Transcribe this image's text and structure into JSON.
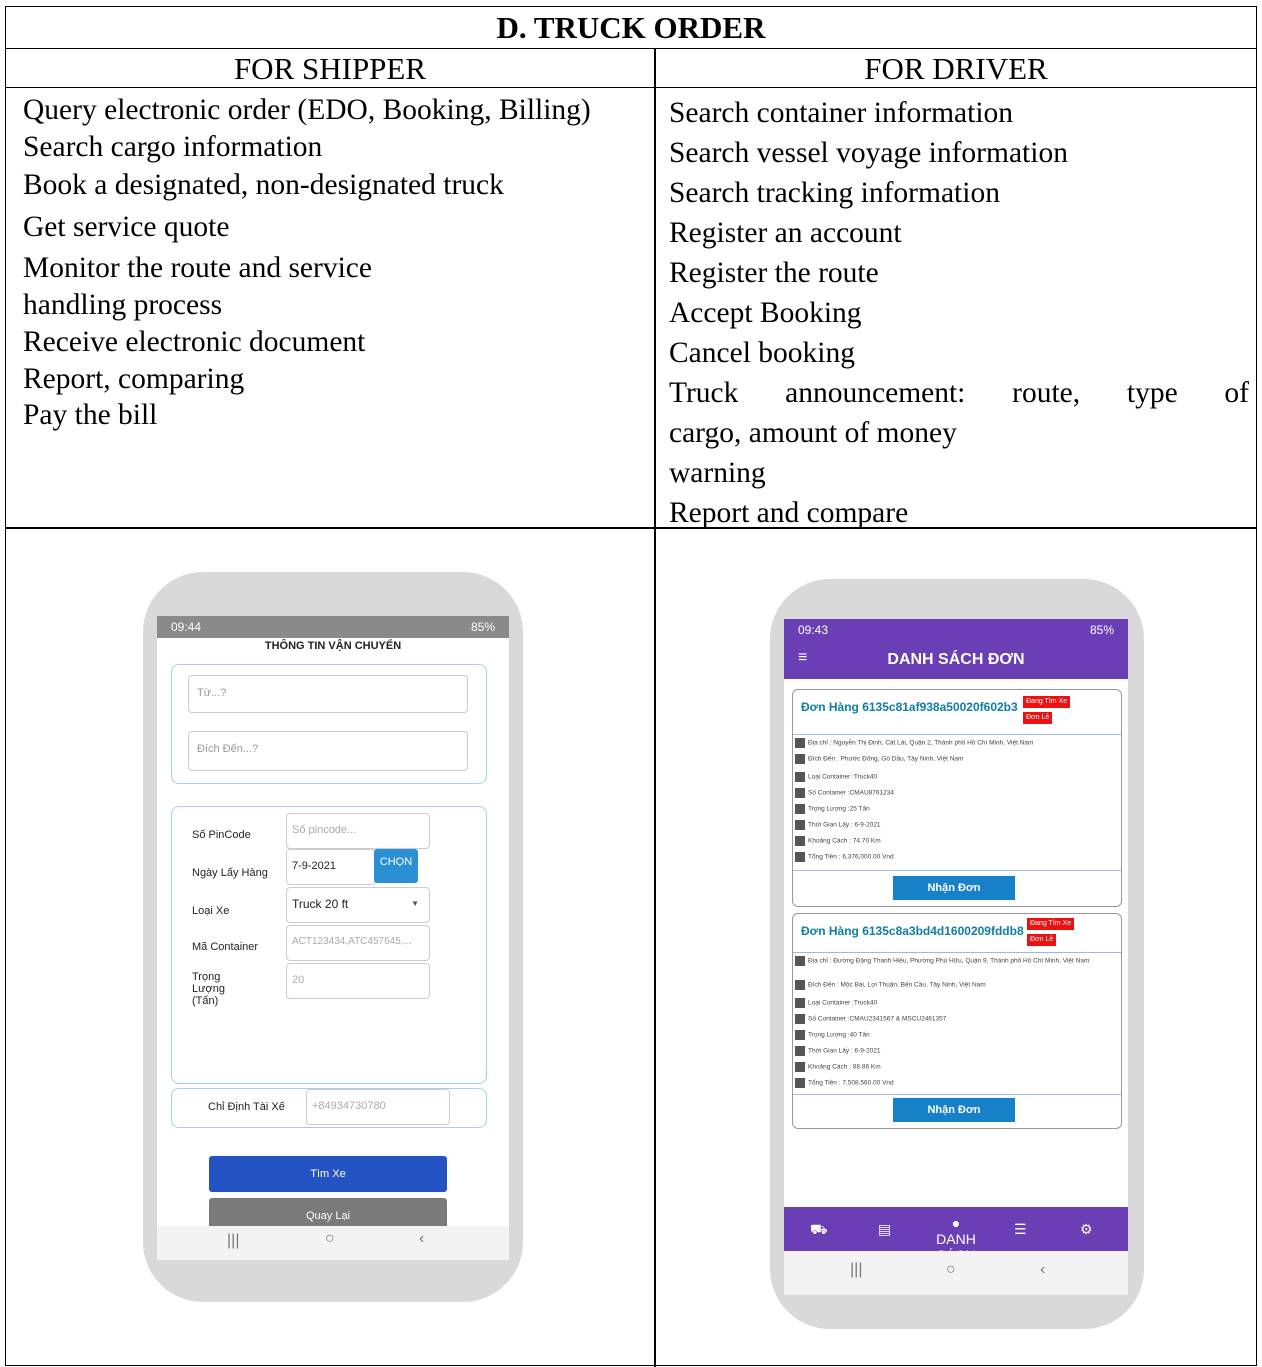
{
  "title": "D. TRUCK ORDER",
  "columns": {
    "left": "FOR SHIPPER",
    "right": "FOR DRIVER"
  },
  "shipper_items": [
    "Query electronic order (EDO, Booking, Billing)",
    "Search cargo information",
    "Book a designated, non-designated truck",
    "Get service quote",
    "Monitor the route and service",
    "handling process",
    "Receive electronic document",
    "Report, comparing",
    "Pay the bill"
  ],
  "driver_items": [
    "Search container information",
    "Search vessel voyage information",
    "Search tracking information",
    "Register an account",
    "Register the route",
    "Accept Booking",
    "Cancel booking",
    "Truck announcement: route, type of",
    "cargo, amount of money",
    "warning",
    "Report and compare"
  ],
  "shipper_phone": {
    "time": "09:44",
    "status": "85%",
    "title": "THÔNG TIN VẬN CHUYỂN",
    "from_placeholder": "Từ...?",
    "to_placeholder": "Đích Đến...?",
    "pincode_label": "Số PinCode",
    "pincode_placeholder": "Số pincode...",
    "date_label": "Ngày Lấy Hàng",
    "date_value": "7-9-2021",
    "choose": "CHỌN",
    "truck_label": "Loại Xe",
    "truck_value": "Truck 20 ft",
    "container_label": "Mã Container",
    "container_placeholder": "ACT123434,ATC457645,...",
    "weight_label": "Trọng Lượng (Tấn)",
    "weight_value": "20",
    "driver_label": "Chỉ Định Tài Xế",
    "driver_value": "+84934730780",
    "find_button": "Tìm Xe",
    "back_button": "Quay Lại"
  },
  "driver_phone": {
    "time": "09:43",
    "status": "85%",
    "header": "DANH SÁCH ĐƠN",
    "orders": [
      {
        "id": "Đơn Hàng 6135c81af938a50020f602b3",
        "tag1": "Đang Tìm Xe",
        "tag2": "Đơn Lẻ",
        "address": "Địa chỉ : Nguyễn Thị Định, Cát Lái, Quận 2, Thành phố Hồ Chí Minh, Việt Nam",
        "dest": "Đích Đến : Phước Đông, Gò Dầu, Tây Ninh, Việt Nam",
        "container_type": "Loại Container :Truck40",
        "container_no": "Số Container :CMAU8761234",
        "weight": "Trọng Lượng :25 Tấn",
        "pickup": "Thời Gian Lấy : 6-9-2021",
        "distance": "Khoảng Cách : 74.70 Km",
        "total": "Tổng Tiền : 6,376,000.00 Vnd",
        "accept": "Nhận Đơn"
      },
      {
        "id": "Đơn Hàng 6135c8a3bd4d1600209fddb8",
        "tag1": "Đang Tìm Xe",
        "tag2": "Đơn Lẻ",
        "address": "Địa chỉ : Đường Đặng Thanh Hiếu, Phường Phú Hữu, Quận 9, Thành phố Hồ Chí Minh, Việt Nam",
        "dest": "Đích Đến : Mộc Bài, Lợi Thuận, Bến Cầu, Tây Ninh, Việt Nam",
        "container_type": "Loại Container :Truck40",
        "container_no": "Số Container :CMAU2341567 & MSCU2461357",
        "weight": "Trọng Lượng :40 Tấn",
        "pickup": "Thời Gian Lấy : 6-9-2021",
        "distance": "Khoảng Cách : 88.86 Km",
        "total": "Tổng Tiền : 7,508,560.00 Vnd",
        "accept": "Nhận Đơn"
      }
    ],
    "active_tab": "DANH SÁCH"
  },
  "icons": [
    "truck-icon",
    "clipboard-icon",
    "location-pin-icon",
    "user-list-icon",
    "gear-icon",
    "menu-icon",
    "ruler-icon",
    "scale-icon",
    "calendar-icon",
    "money-icon",
    "barcode-icon",
    "home-nav-icon",
    "back-nav-icon",
    "recent-nav-icon"
  ]
}
